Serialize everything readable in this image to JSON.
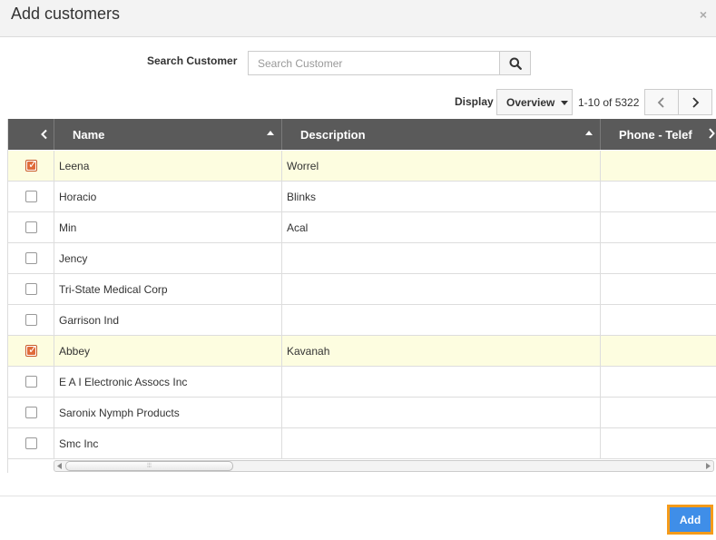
{
  "dialog": {
    "title": "Add customers",
    "close_glyph": "×"
  },
  "search": {
    "label": "Search Customer",
    "placeholder": "Search Customer",
    "value": "",
    "icon": "search-icon"
  },
  "toolbar": {
    "display_label": "Display",
    "display_value": "Overview",
    "pager_text": "1-10 of 5322"
  },
  "table": {
    "columns": [
      {
        "label": "Name"
      },
      {
        "label": "Description"
      },
      {
        "label": "Phone - Telef"
      }
    ],
    "rows": [
      {
        "checked": true,
        "name": "Leena",
        "description": "Worrel"
      },
      {
        "checked": false,
        "name": "Horacio",
        "description": "Blinks"
      },
      {
        "checked": false,
        "name": "Min",
        "description": "Acal"
      },
      {
        "checked": false,
        "name": "Jency",
        "description": ""
      },
      {
        "checked": false,
        "name": "Tri-State Medical Corp",
        "description": ""
      },
      {
        "checked": false,
        "name": "Garrison Ind",
        "description": ""
      },
      {
        "checked": true,
        "name": "Abbey",
        "description": "Kavanah"
      },
      {
        "checked": false,
        "name": "E A I Electronic Assocs Inc",
        "description": ""
      },
      {
        "checked": false,
        "name": "Saronix Nymph Products",
        "description": ""
      },
      {
        "checked": false,
        "name": "Smc Inc",
        "description": ""
      }
    ]
  },
  "footer": {
    "add_label": "Add"
  },
  "colors": {
    "header_bg": "#5a5a5a",
    "selected_row_bg": "#fdfde0",
    "checkbox_checked": "#e06b3b",
    "add_button_bg": "#3f8ee8",
    "add_button_border": "#f59b1a"
  }
}
